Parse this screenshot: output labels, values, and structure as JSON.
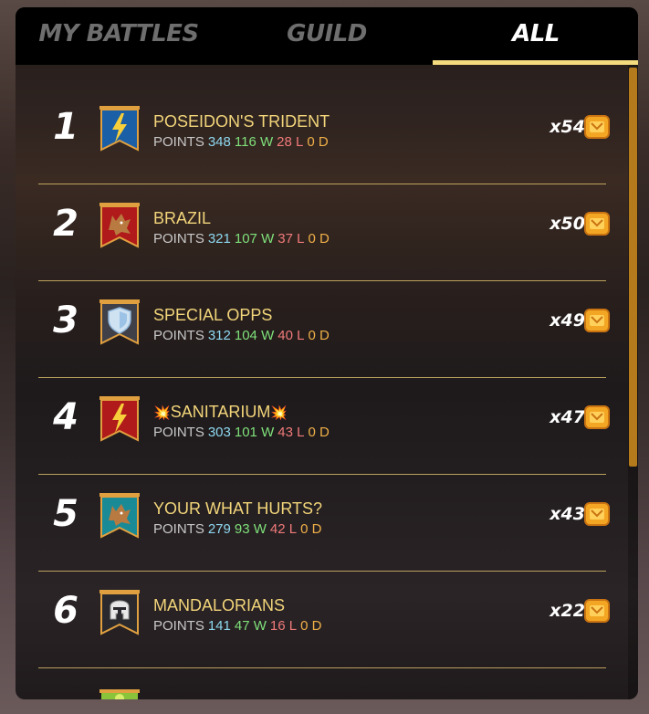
{
  "tabs": [
    {
      "label": "MY BATTLES",
      "active": false
    },
    {
      "label": "GUILD",
      "active": false
    },
    {
      "label": "ALL",
      "active": true
    }
  ],
  "stats_labels": {
    "points": "POINTS",
    "wins_suffix": "W",
    "losses_suffix": "L",
    "draws_suffix": "D"
  },
  "colors": {
    "accent": "#f4dc7e",
    "name": "#f2d57a",
    "points": "#8ed8f0",
    "wins": "#7fe07a",
    "losses": "#f07a7a",
    "draws": "#f0b048"
  },
  "rows": [
    {
      "rank": "1",
      "name": "POSEIDON'S TRIDENT",
      "points": "348",
      "wins": "116 W",
      "losses": "28 L",
      "draws": "0 D",
      "reward": "x54",
      "banner_icon": "lightning-icon",
      "banner_color": "#1b5fa6"
    },
    {
      "rank": "2",
      "name": "BRAZIL",
      "points": "321",
      "wins": "107 W",
      "losses": "37 L",
      "draws": "0 D",
      "reward": "x50",
      "banner_icon": "wolf-icon",
      "banner_color": "#b01a1a"
    },
    {
      "rank": "3",
      "name": "SPECIAL OPPS",
      "points": "312",
      "wins": "104 W",
      "losses": "40 L",
      "draws": "0 D",
      "reward": "x49",
      "banner_icon": "shield-icon",
      "banner_color": "#404048"
    },
    {
      "rank": "4",
      "name": "SANITARIUM",
      "name_prefix": "💥",
      "name_suffix": "💥",
      "points": "303",
      "wins": "101 W",
      "losses": "43 L",
      "draws": "0 D",
      "reward": "x47",
      "banner_icon": "lightning-icon",
      "banner_color": "#b01a1a"
    },
    {
      "rank": "5",
      "name": "YOUR WHAT HURTS?",
      "points": "279",
      "wins": "93 W",
      "losses": "42 L",
      "draws": "0 D",
      "reward": "x43",
      "banner_icon": "wolf-icon",
      "banner_color": "#1a8a96"
    },
    {
      "rank": "6",
      "name": "MANDALORIANS",
      "points": "141",
      "wins": "47 W",
      "losses": "16 L",
      "draws": "0 D",
      "reward": "x22",
      "banner_icon": "helmet-icon",
      "banner_color": "#2a2a2e"
    }
  ]
}
